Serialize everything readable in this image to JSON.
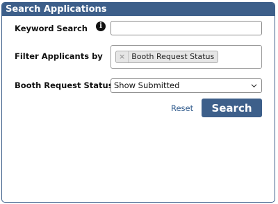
{
  "panel": {
    "title": "Search Applications"
  },
  "keyword": {
    "label": "Keyword Search",
    "value": "",
    "icon": "info-icon"
  },
  "filter": {
    "label": "Filter Applicants by",
    "chips": [
      {
        "label": "Booth Request Status",
        "remove_glyph": "×"
      }
    ]
  },
  "booth_status": {
    "label": "Booth Request Status",
    "selected": "Show Submitted"
  },
  "actions": {
    "reset_label": "Reset",
    "search_label": "Search"
  },
  "colors": {
    "accent": "#3d5f8a",
    "link": "#2f5a8c"
  }
}
